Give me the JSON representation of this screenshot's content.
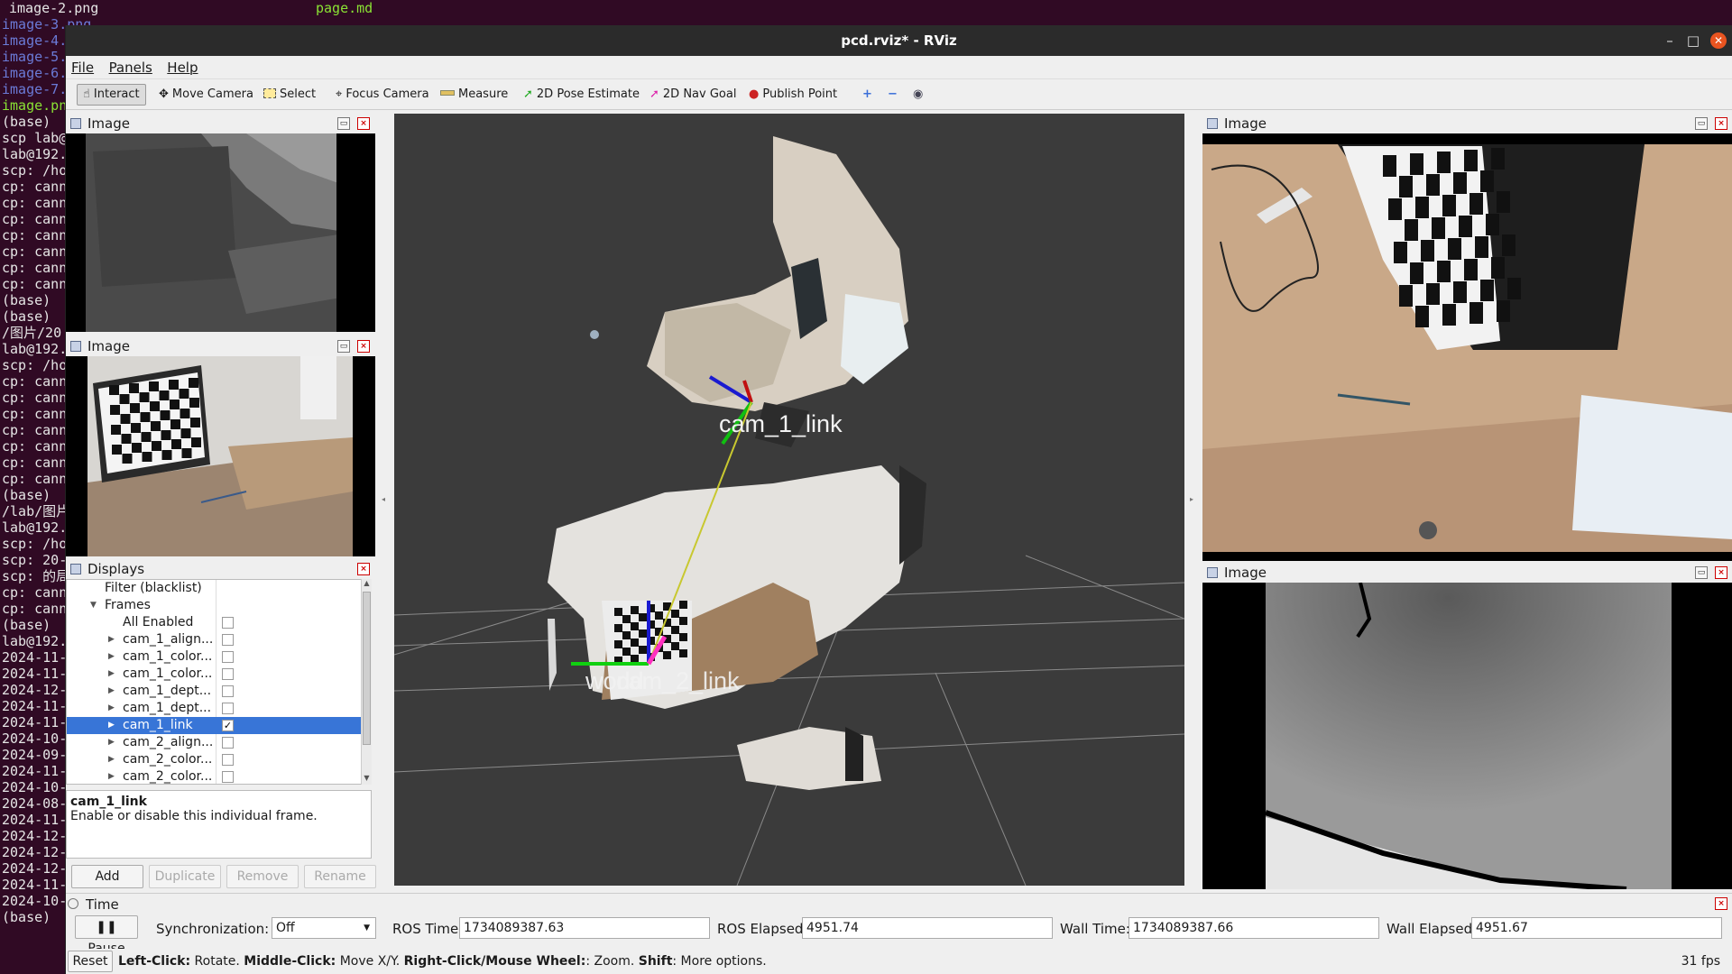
{
  "terminal": {
    "top_left": "image-2.png",
    "top_mid": "page.md",
    "lines": [
      "image-3.png",
      "image-4.png",
      "image-5.png",
      "image-6.png",
      "image-7.png",
      "image.png",
      "(base)",
      "scp lab@",
      "lab@192.",
      "scp: /ho",
      "cp: cann",
      "cp: cann",
      "cp: cann",
      "cp: cann",
      "cp: cann",
      "cp: cann",
      "cp: cann",
      "(base)",
      "(base)",
      "/图片/20",
      "lab@192.",
      "scp: /ho",
      "cp: cann",
      "cp: cann",
      "cp: cann",
      "cp: cann",
      "cp: cann",
      "cp: cann",
      "cp: cann",
      "(base)",
      "/lab/图片",
      "lab@192.",
      "scp: /ho",
      "scp: 20-",
      "scp: 的局",
      "cp: cann",
      "cp: cann",
      "(base)",
      "lab@192.",
      "2024-11-",
      "2024-11-",
      "2024-12-",
      "2024-11-",
      "2024-11-",
      "2024-10-",
      "2024-09-",
      "2024-11-",
      "2024-10-",
      "2024-08-",
      "2024-11-",
      "2024-12-",
      "2024-12-",
      "2024-12-",
      "2024-11-",
      "2024-10-",
      "(base)"
    ]
  },
  "window": {
    "title": "pcd.rviz* - RViz",
    "min": "–",
    "max": "□",
    "close": "✕"
  },
  "menu": [
    "File",
    "Panels",
    "Help"
  ],
  "toolbar": {
    "interact": "Interact",
    "move_camera": "Move Camera",
    "select": "Select",
    "focus_camera": "Focus Camera",
    "measure": "Measure",
    "pose_estimate": "2D Pose Estimate",
    "nav_goal": "2D Nav Goal",
    "publish_point": "Publish Point",
    "plus": "+",
    "minus": "−",
    "eye": "◉"
  },
  "panels": {
    "image_title": "Image",
    "displays_title": "Displays"
  },
  "displays": {
    "filter": "Filter (blacklist)",
    "frames": "Frames",
    "all_enabled": "All Enabled",
    "items": [
      "cam_1_align...",
      "cam_1_color...",
      "cam_1_color...",
      "cam_1_dept...",
      "cam_1_dept...",
      "cam_1_link",
      "cam_2_align...",
      "cam_2_color...",
      "cam_2_color..."
    ],
    "selected_index": 5,
    "checked_mark": "✓",
    "desc_title": "cam_1_link",
    "desc_text": "Enable or disable this individual frame.",
    "buttons": [
      "Add",
      "Duplicate",
      "Remove",
      "Rename"
    ]
  },
  "scene": {
    "label_cam1": "cam_1_link",
    "label_world": "world",
    "label_cam2": "cam_2_link"
  },
  "time": {
    "title": "Time",
    "pause": "Pause",
    "sync_label": "Synchronization:",
    "sync_value": "Off",
    "ros_time_label": "ROS Time:",
    "ros_time": "1734089387.63",
    "ros_elapsed_label": "ROS Elapsed:",
    "ros_elapsed": "4951.74",
    "wall_time_label": "Wall Time:",
    "wall_time": "1734089387.66",
    "wall_elapsed_label": "Wall Elapsed:",
    "wall_elapsed": "4951.67"
  },
  "status": {
    "reset": "Reset",
    "h1": "Left-Click:",
    "t1": " Rotate. ",
    "h2": "Middle-Click:",
    "t2": " Move X/Y. ",
    "h3": "Right-Click/Mouse Wheel:",
    "t3": ": Zoom. ",
    "h4": "Shift",
    "t4": ": More options.",
    "fps": "31 fps"
  },
  "colors": {
    "accent_selection": "#3875d7",
    "viewport_bg": "#3a3a3a",
    "axis_x": "#e01010",
    "axis_y": "#10d010",
    "axis_z": "#1010e0",
    "link_line": "#c8c830"
  }
}
